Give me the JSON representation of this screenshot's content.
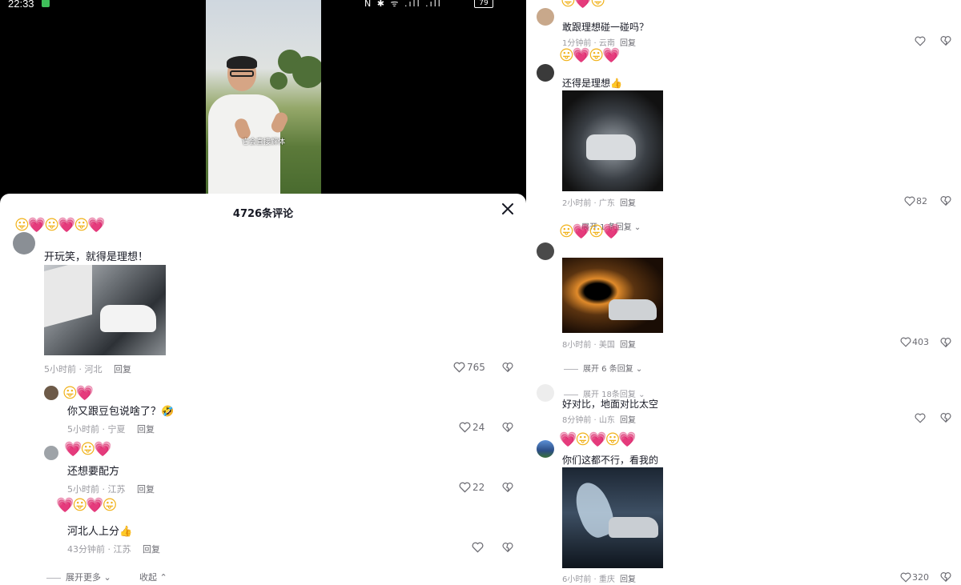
{
  "status_bar": {
    "time": "22:33",
    "icons_text": "N ✱ ᯤ .ıll .ıll",
    "battery": "79"
  },
  "video": {
    "caption": "它会直接解体"
  },
  "panel": {
    "title": "4726条评论"
  },
  "left_comments": [
    {
      "text": "开玩笑，就得是理想！",
      "meta": "5小时前 · 河北",
      "reply": "回复",
      "likes": "765"
    },
    {
      "text": "你又跟豆包说啥了？🤣",
      "meta": "5小时前 · 宁夏",
      "reply": "回复",
      "likes": "24"
    },
    {
      "text": "还想要配方",
      "meta": "5小时前 · 江苏",
      "reply": "回复",
      "likes": "22"
    },
    {
      "text": "河北人上分👍",
      "meta": "43分钟前 · 江苏",
      "reply": "回复",
      "likes": ""
    }
  ],
  "left_footer": {
    "expand_more": "展开更多",
    "collapse": "收起"
  },
  "right_comments": [
    {
      "text": "敢跟理想碰一碰吗？",
      "meta": "1分钟前 · 云南",
      "reply": "回复",
      "likes": ""
    },
    {
      "text": "还得是理想👍",
      "meta": "2小时前 · 广东",
      "reply": "回复",
      "likes": "82",
      "expand": "展开 1 条回复"
    },
    {
      "text": "",
      "meta": "8小时前 · 美国",
      "reply": "回复",
      "likes": "403",
      "expand": "展开 6 条回复"
    },
    {
      "text": "好对比，地面对比太空",
      "meta": "8分钟前 · 山东",
      "reply": "回复",
      "likes": "",
      "expand_above": "展开 18条回复"
    },
    {
      "text": "你们这都不行，看我的",
      "meta": "6小时前 · 重庆",
      "reply": "回复",
      "likes": "320"
    }
  ],
  "colors": {
    "heart_pink": "#ea5ba6",
    "emoji_yellow": "#f1b21a",
    "meta_gray": "#9a9aa0"
  }
}
